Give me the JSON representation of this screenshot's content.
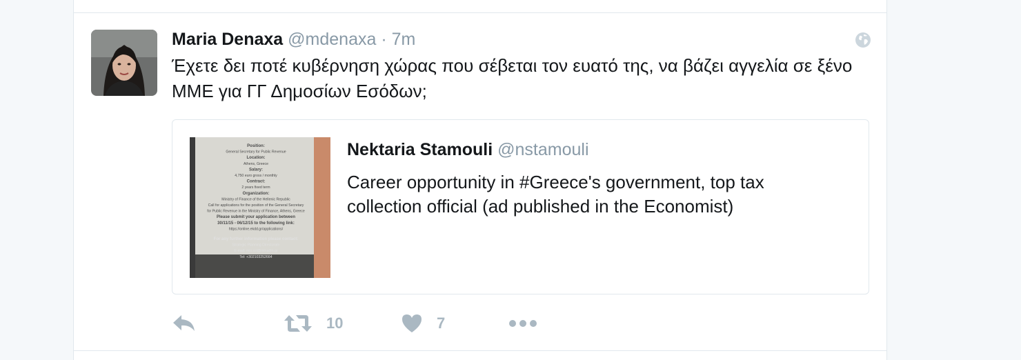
{
  "tweet": {
    "fullname": "Maria Denaxa",
    "username": "@mdenaxa",
    "separator": "·",
    "time": "7m",
    "text": "Έχετε δει ποτέ κυβέρνηση χώρας που σέβεται τον ευατό της, να βάζει αγγελία σε ξένο ΜΜΕ για ΓΓ Δημοσίων Εσόδων;",
    "visibility_icon": "globe-icon"
  },
  "quote": {
    "fullname": "Nektaria Stamouli",
    "username": "@nstamouli",
    "text": "Career opportunity in #Greece's government, top tax collection official (ad published in the Economist)",
    "image": {
      "lines": [
        "Position:",
        "General Secretary for Public Revenue",
        "Location:",
        "Athens, Greece",
        "Salary:",
        "4,750 euro gross / monthly",
        "Contract:",
        "2 years fixed term",
        "Organization:",
        "Ministry of Finance of the Hellenic Republic",
        "Call for applications for the position of the General Secretary",
        "for Public Revenue in the Ministry of Finance, Athens, Greece",
        "Please submit your application between",
        "30/11/15 - 06/12/15 to the following link:",
        "https://online.ekdd.gr/applications/",
        "For any further information please contact:",
        "Strategic Planning Directorate",
        "E-mail: mis.ssl@minadm.gr",
        "Tel: +302103252664"
      ]
    }
  },
  "actions": {
    "reply_icon": "reply-icon",
    "retweet_icon": "retweet-icon",
    "retweet_count": "10",
    "like_icon": "heart-icon",
    "like_count": "7",
    "more_icon": "more-icon"
  },
  "colors": {
    "text": "#14171a",
    "muted": "#8899a6",
    "action": "#aab8c2",
    "border": "#e1e8ed",
    "background": "#f5f8fa"
  }
}
